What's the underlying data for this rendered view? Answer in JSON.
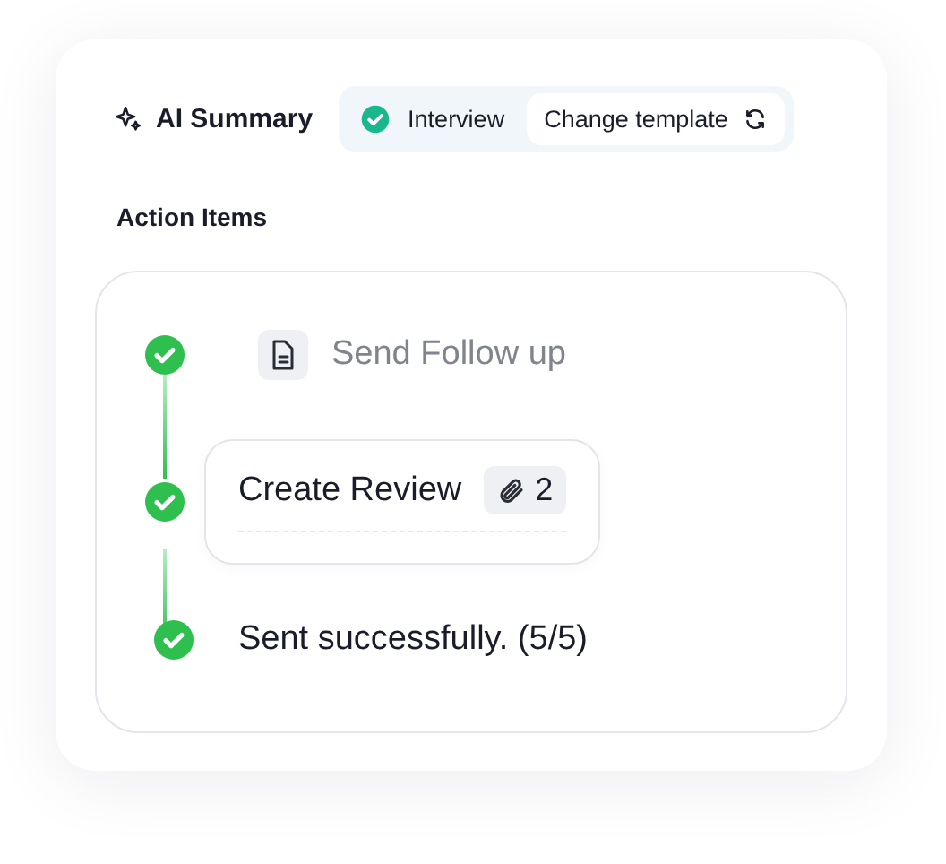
{
  "header": {
    "title": "AI Summary",
    "template": {
      "name": "Interview",
      "checked": true
    },
    "change_button": "Change template"
  },
  "section_title": "Action Items",
  "steps": [
    {
      "kind": "doc",
      "label": "Send Follow up",
      "done": true
    },
    {
      "kind": "card",
      "label": "Create Review",
      "attachments": "2",
      "done": true
    },
    {
      "kind": "plain",
      "label": "Sent successfully. (5/5)",
      "done": true
    }
  ]
}
